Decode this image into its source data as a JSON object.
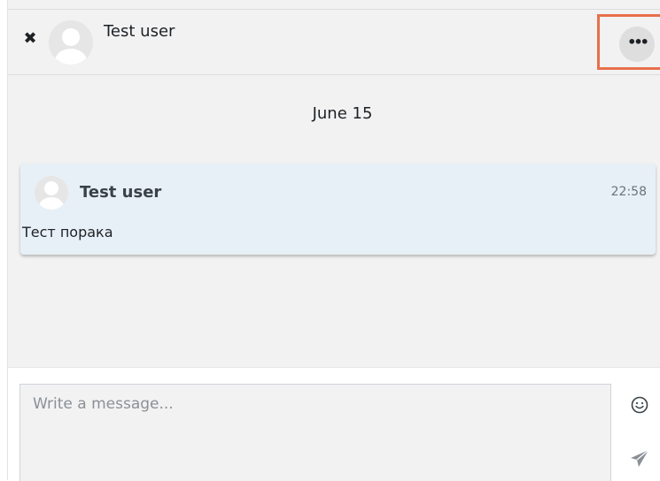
{
  "header": {
    "close_icon": "close-icon",
    "user_name": "Test user",
    "more_icon": "more-options-icon",
    "more_label": "•••"
  },
  "conversation": {
    "date": "June 15",
    "messages": [
      {
        "sender": "Test user",
        "time": "22:58",
        "text": "Тест порака"
      }
    ]
  },
  "composer": {
    "placeholder": "Write a message...",
    "emoji_icon": "emoji-icon",
    "send_icon": "send-icon"
  },
  "colors": {
    "highlight": "#e8704a",
    "message_bg": "#e8f0f7",
    "panel_bg": "#f2f2f2"
  }
}
